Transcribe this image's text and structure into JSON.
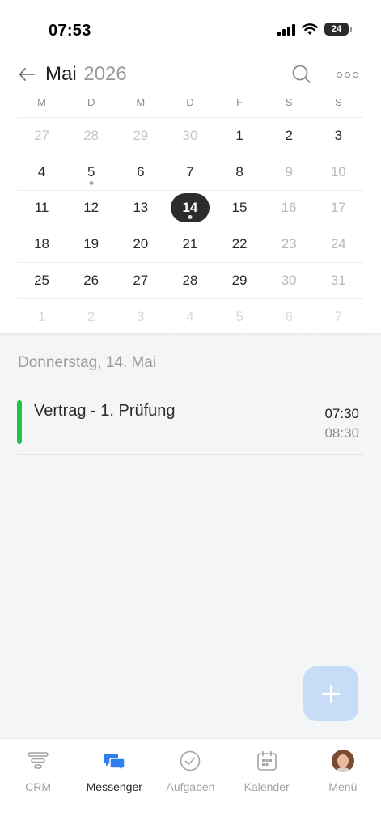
{
  "status_bar": {
    "time": "07:53",
    "battery": "24"
  },
  "header": {
    "month": "Mai",
    "year": "2026"
  },
  "calendar": {
    "weekdays": [
      "M",
      "D",
      "M",
      "D",
      "F",
      "S",
      "S"
    ],
    "weeks": [
      [
        "27",
        "28",
        "29",
        "30",
        "1",
        "2",
        "3"
      ],
      [
        "4",
        "5",
        "6",
        "7",
        "8",
        "9",
        "10"
      ],
      [
        "11",
        "12",
        "13",
        "14",
        "15",
        "16",
        "17"
      ],
      [
        "18",
        "19",
        "20",
        "21",
        "22",
        "23",
        "24"
      ],
      [
        "25",
        "26",
        "27",
        "28",
        "29",
        "30",
        "31"
      ],
      [
        "1",
        "2",
        "3",
        "4",
        "5",
        "6",
        "7"
      ]
    ],
    "selected_day": "14",
    "days_with_events": [
      "5",
      "14"
    ]
  },
  "agenda": {
    "date_heading": "Donnerstag, 14. Mai",
    "events": [
      {
        "title": "Vertrag - 1. Prüfung",
        "start": "07:30",
        "end": "08:30",
        "color": "#22c149"
      }
    ]
  },
  "tab_bar": {
    "tabs": [
      {
        "label": "CRM",
        "icon": "crm-funnel-icon"
      },
      {
        "label": "Messenger",
        "icon": "messenger-chat-icon",
        "active": true
      },
      {
        "label": "Aufgaben",
        "icon": "tasks-check-icon"
      },
      {
        "label": "Kalender",
        "icon": "calendar-icon"
      },
      {
        "label": "Menü",
        "icon": "avatar"
      }
    ]
  },
  "colors": {
    "accent": "#2f7ff0",
    "fab": "#c7dcf7",
    "selected_day": "#2c2c2c",
    "event": "#22c149"
  }
}
